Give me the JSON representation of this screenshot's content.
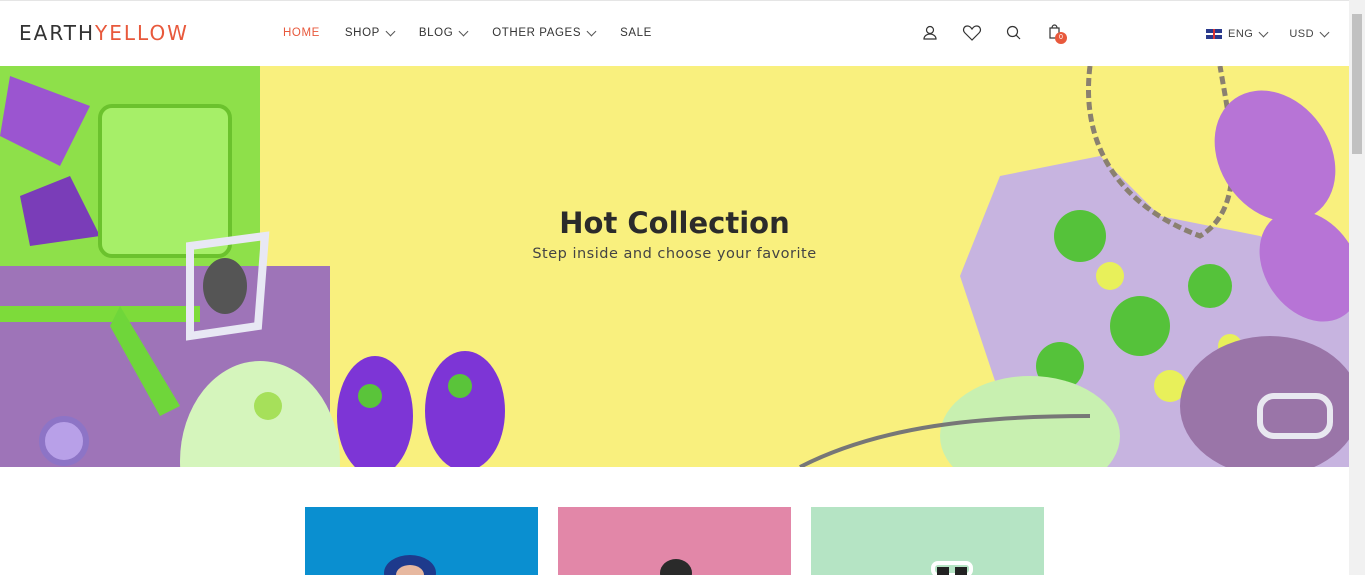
{
  "logo": {
    "part1": "EARTH",
    "part2": "YELLOW"
  },
  "nav": [
    {
      "label": "HOME",
      "active": true,
      "dropdown": false
    },
    {
      "label": "SHOP",
      "active": false,
      "dropdown": true
    },
    {
      "label": "BLOG",
      "active": false,
      "dropdown": true
    },
    {
      "label": "OTHER PAGES",
      "active": false,
      "dropdown": true
    },
    {
      "label": "SALE",
      "active": false,
      "dropdown": false
    }
  ],
  "icons": [
    "user-icon",
    "heart-icon",
    "search-icon",
    "cart-icon"
  ],
  "cart": {
    "count": "0"
  },
  "locale": {
    "language": "ENG",
    "currency": "USD"
  },
  "hero": {
    "title": "Hot Collection",
    "subtitle": "Step inside and choose your favorite"
  },
  "colors": {
    "accent": "#e8593c",
    "hero_bg": "#f9f07e",
    "card1": "#0a8fd0",
    "card2": "#e287a8",
    "card3": "#b5e4c4"
  }
}
